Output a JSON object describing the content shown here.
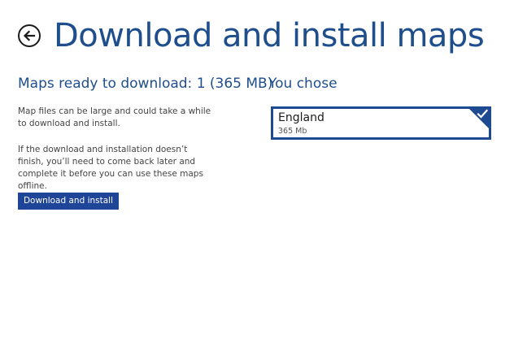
{
  "header": {
    "back_icon": "back-arrow-icon",
    "title": "Download and install maps"
  },
  "left_panel": {
    "heading": "Maps ready to download: 1 (365 MB)",
    "paragraph_1": "Map files can be large and could take a while to download and install.",
    "paragraph_2": "If the download and installation doesn’t finish, you’ll need to come back later and complete it before you can use these maps offline.",
    "button_label": "Download and install"
  },
  "right_panel": {
    "heading": "You chose",
    "selected_maps": [
      {
        "name": "England",
        "size": "365 Mb",
        "selected": true
      }
    ]
  },
  "colors": {
    "accent": "#1e4e8c",
    "button": "#1e4597",
    "tile_border": "#1d4a91",
    "background": "#ffffff"
  }
}
